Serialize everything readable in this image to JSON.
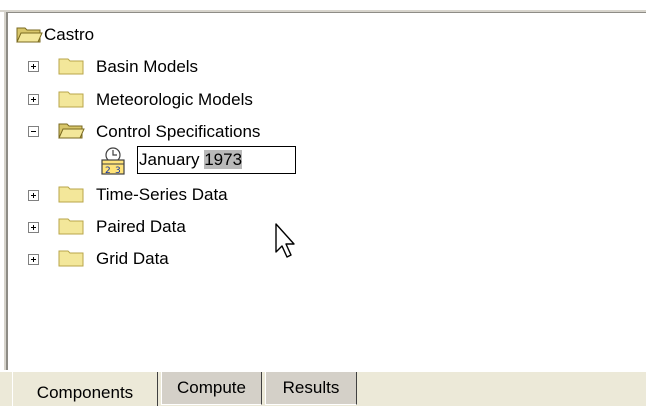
{
  "tree": {
    "root": {
      "label": "Castro",
      "icon": "open-folder-icon"
    },
    "items": [
      {
        "label": "Basin Models",
        "expander": "plus",
        "icon": "folder-icon"
      },
      {
        "label": "Meteorologic Models",
        "expander": "plus",
        "icon": "folder-icon"
      },
      {
        "label": "Control Specifications",
        "expander": "minus",
        "icon": "open-folder-icon"
      },
      {
        "label": "Time-Series Data",
        "expander": "plus",
        "icon": "folder-icon"
      },
      {
        "label": "Paired Data",
        "expander": "plus",
        "icon": "folder-icon"
      },
      {
        "label": "Grid Data",
        "expander": "plus",
        "icon": "folder-icon"
      }
    ],
    "child": {
      "icon": "calendar-clock-icon",
      "edit_text_plain": "January ",
      "edit_text_selected": "1973"
    }
  },
  "tabs": [
    {
      "label": "Components",
      "active": true
    },
    {
      "label": "Compute",
      "active": false
    },
    {
      "label": "Results",
      "active": false
    }
  ]
}
